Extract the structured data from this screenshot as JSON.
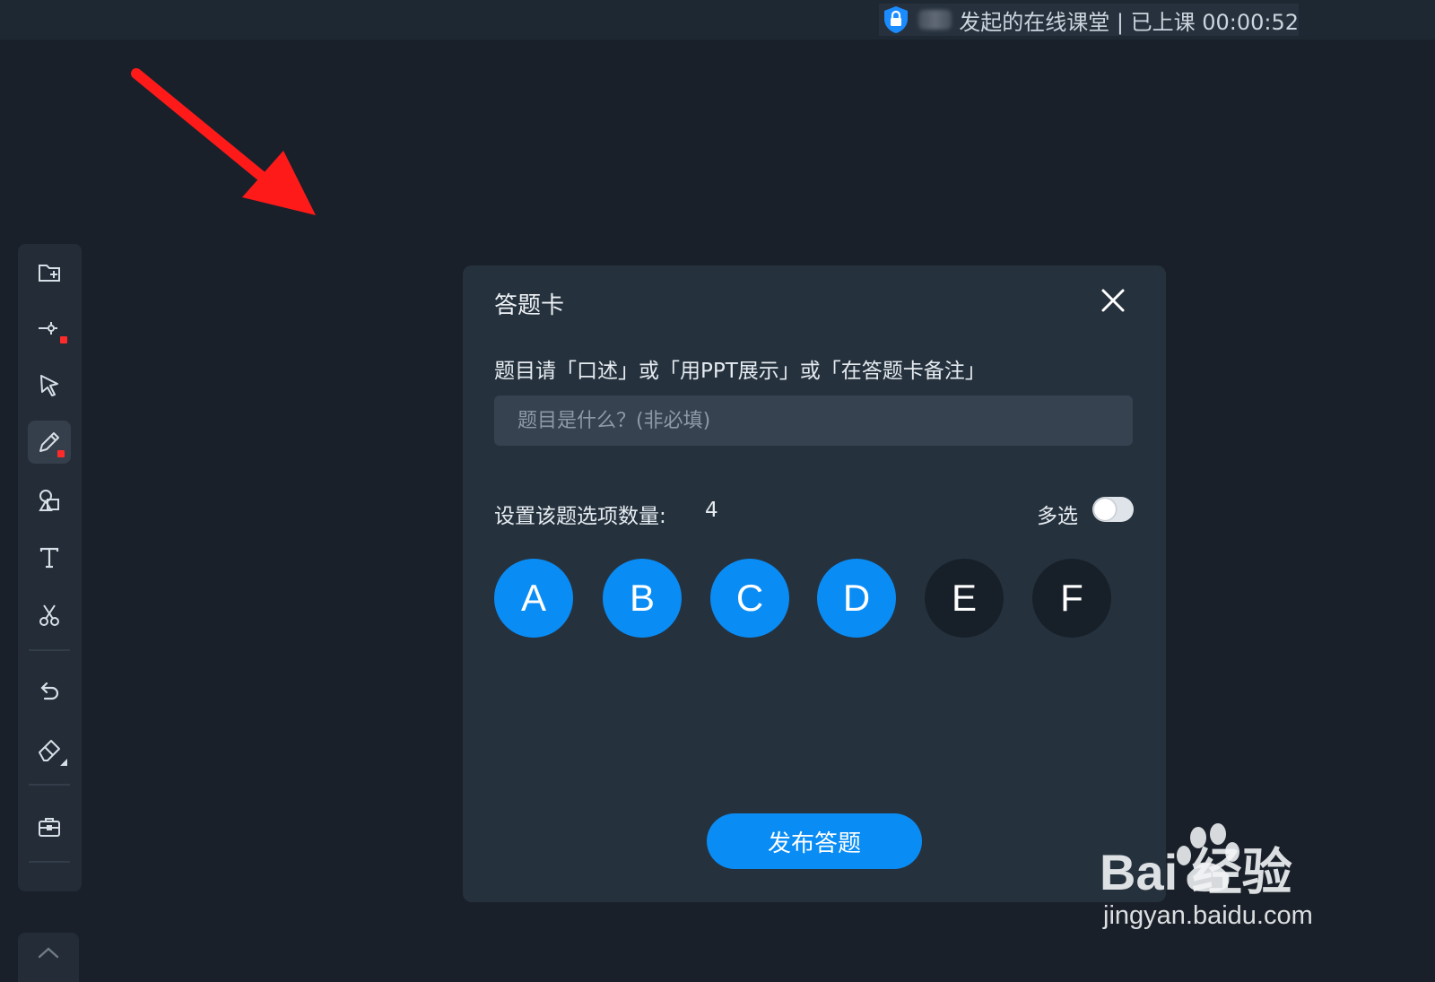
{
  "session": {
    "title": "发起的在线课堂 | 已上课 00:00:52",
    "shield_icon": "lock-shield-icon",
    "owner_name": "(redacted)"
  },
  "toolbar": {
    "tools": [
      {
        "name": "new-page-icon",
        "active": false
      },
      {
        "name": "laser-pointer-icon",
        "active": false
      },
      {
        "name": "select-arrow-icon",
        "active": false
      },
      {
        "name": "pen-icon",
        "active": true
      },
      {
        "name": "shapes-icon",
        "active": false
      },
      {
        "name": "text-icon",
        "active": false
      },
      {
        "name": "scissors-icon",
        "active": false
      },
      {
        "name": "undo-icon",
        "active": false
      },
      {
        "name": "eraser-icon",
        "active": false
      },
      {
        "name": "toolbox-icon",
        "active": false
      }
    ],
    "collapse_icon": "chevron-up-icon"
  },
  "dialog": {
    "title": "答题卡",
    "hint": "题目请「口述」或「用PPT展示」或「在答题卡备注」",
    "question_placeholder": "题目是什么？(非必填)",
    "question_value": "",
    "option_count_label": "设置该题选项数量:",
    "option_count": "4",
    "multi_select_label": "多选",
    "multi_select_on": false,
    "options": [
      {
        "label": "A",
        "selected": true
      },
      {
        "label": "B",
        "selected": true
      },
      {
        "label": "C",
        "selected": true
      },
      {
        "label": "D",
        "selected": true
      },
      {
        "label": "E",
        "selected": false
      },
      {
        "label": "F",
        "selected": false
      }
    ],
    "publish_label": "发布答题"
  },
  "watermark": {
    "brand": "Bai 经验",
    "url": "jingyan.baidu.com"
  },
  "colors": {
    "accent": "#0a8cf5",
    "background": "#1a2029",
    "dialog": "#25323e",
    "annotation_arrow": "#ff1a1a"
  }
}
